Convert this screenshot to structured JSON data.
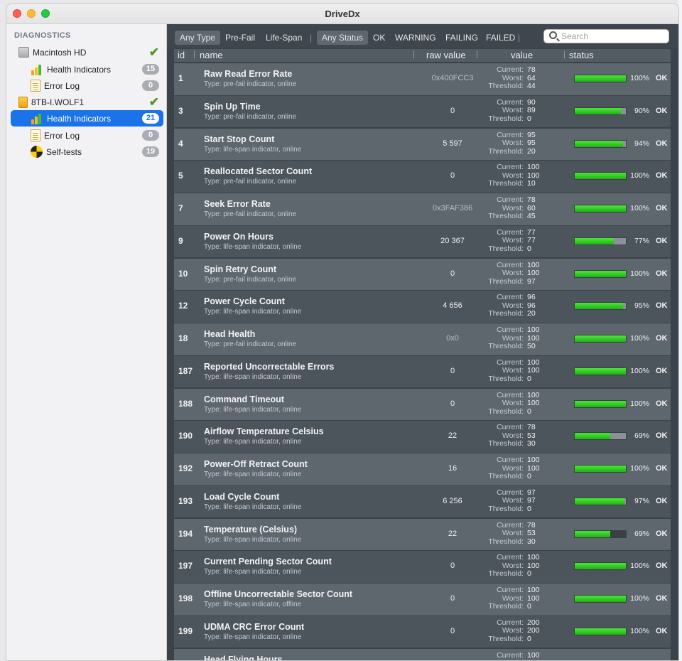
{
  "window": {
    "title": "DriveDx"
  },
  "sidebar": {
    "heading": "DIAGNOSTICS",
    "items": [
      {
        "label": "Macintosh HD"
      },
      {
        "label": "Health Indicators",
        "badge": "15"
      },
      {
        "label": "Error Log",
        "badge": "0"
      },
      {
        "label": "8TB-I.WOLF1"
      },
      {
        "label": "Health Indicators",
        "badge": "21"
      },
      {
        "label": "Error Log",
        "badge": "0"
      },
      {
        "label": "Self-tests",
        "badge": "19"
      }
    ]
  },
  "filters": {
    "type": [
      "Any Type",
      "Pre-Fail",
      "Life-Span"
    ],
    "status": [
      "Any Status",
      "OK",
      "WARNING",
      "FAILING",
      "FAILED"
    ],
    "search_placeholder": "Search"
  },
  "columns": {
    "id": "id",
    "name": "name",
    "raw": "raw value",
    "value": "value",
    "status": "status"
  },
  "labels": {
    "current": "Current:",
    "worst": "Worst:",
    "threshold": "Threshold:"
  },
  "rows": [
    {
      "id": "1",
      "name": "Raw Read Error Rate",
      "type": "Type: pre-fail indicator, online",
      "raw": "0x400FCC3",
      "hex": true,
      "current": "78",
      "worst": "64",
      "threshold": "44",
      "pct": "100%",
      "fill": 1.0,
      "status": "OK"
    },
    {
      "id": "3",
      "name": "Spin Up Time",
      "type": "Type: pre-fail indicator, online",
      "raw": "0",
      "hex": false,
      "current": "90",
      "worst": "89",
      "threshold": "0",
      "pct": "90%",
      "fill": 0.9,
      "status": "OK"
    },
    {
      "id": "4",
      "name": "Start Stop Count",
      "type": "Type: life-span indicator, online",
      "raw": "5 597",
      "hex": false,
      "current": "95",
      "worst": "95",
      "threshold": "20",
      "pct": "94%",
      "fill": 0.94,
      "status": "OK"
    },
    {
      "id": "5",
      "name": "Reallocated Sector Count",
      "type": "Type: pre-fail indicator, online",
      "raw": "0",
      "hex": false,
      "current": "100",
      "worst": "100",
      "threshold": "10",
      "pct": "100%",
      "fill": 1.0,
      "status": "OK"
    },
    {
      "id": "7",
      "name": "Seek Error Rate",
      "type": "Type: pre-fail indicator, online",
      "raw": "0x3FAF386",
      "hex": true,
      "current": "78",
      "worst": "60",
      "threshold": "45",
      "pct": "100%",
      "fill": 1.0,
      "status": "OK"
    },
    {
      "id": "9",
      "name": "Power On Hours",
      "type": "Type: life-span indicator, online",
      "raw": "20 367",
      "hex": false,
      "current": "77",
      "worst": "77",
      "threshold": "0",
      "pct": "77%",
      "fill": 0.77,
      "status": "OK"
    },
    {
      "id": "10",
      "name": "Spin Retry Count",
      "type": "Type: pre-fail indicator, online",
      "raw": "0",
      "hex": false,
      "current": "100",
      "worst": "100",
      "threshold": "97",
      "pct": "100%",
      "fill": 1.0,
      "status": "OK"
    },
    {
      "id": "12",
      "name": "Power Cycle Count",
      "type": "Type: life-span indicator, online",
      "raw": "4 656",
      "hex": false,
      "current": "96",
      "worst": "96",
      "threshold": "20",
      "pct": "95%",
      "fill": 0.95,
      "status": "OK"
    },
    {
      "id": "18",
      "name": "Head Health",
      "type": "Type: pre-fail indicator, online",
      "raw": "0x0",
      "hex": true,
      "current": "100",
      "worst": "100",
      "threshold": "50",
      "pct": "100%",
      "fill": 1.0,
      "status": "OK"
    },
    {
      "id": "187",
      "name": "Reported Uncorrectable Errors",
      "type": "Type: life-span indicator, online",
      "raw": "0",
      "hex": false,
      "current": "100",
      "worst": "100",
      "threshold": "0",
      "pct": "100%",
      "fill": 1.0,
      "status": "OK"
    },
    {
      "id": "188",
      "name": "Command Timeout",
      "type": "Type: life-span indicator, online",
      "raw": "0",
      "hex": false,
      "current": "100",
      "worst": "100",
      "threshold": "0",
      "pct": "100%",
      "fill": 1.0,
      "status": "OK"
    },
    {
      "id": "190",
      "name": "Airflow Temperature Celsius",
      "type": "Type: life-span indicator, online",
      "raw": "22",
      "hex": false,
      "current": "78",
      "worst": "53",
      "threshold": "30",
      "pct": "69%",
      "fill": 0.69,
      "status": "OK"
    },
    {
      "id": "192",
      "name": "Power-Off Retract Count",
      "type": "Type: life-span indicator, online",
      "raw": "16",
      "hex": false,
      "current": "100",
      "worst": "100",
      "threshold": "0",
      "pct": "100%",
      "fill": 1.0,
      "status": "OK"
    },
    {
      "id": "193",
      "name": "Load Cycle Count",
      "type": "Type: life-span indicator, online",
      "raw": "6 256",
      "hex": false,
      "current": "97",
      "worst": "97",
      "threshold": "0",
      "pct": "97%",
      "fill": 0.97,
      "status": "OK"
    },
    {
      "id": "194",
      "name": "Temperature (Celsius)",
      "type": "Type: life-span indicator, online",
      "raw": "22",
      "hex": false,
      "current": "78",
      "worst": "53",
      "threshold": "30",
      "pct": "69%",
      "fill": 0.69,
      "status": "OK",
      "dark_track": true
    },
    {
      "id": "197",
      "name": "Current Pending Sector Count",
      "type": "Type: life-span indicator, online",
      "raw": "0",
      "hex": false,
      "current": "100",
      "worst": "100",
      "threshold": "0",
      "pct": "100%",
      "fill": 1.0,
      "status": "OK"
    },
    {
      "id": "198",
      "name": "Offline Uncorrectable Sector Count",
      "type": "Type: life-span indicator, offline",
      "raw": "0",
      "hex": false,
      "current": "100",
      "worst": "100",
      "threshold": "0",
      "pct": "100%",
      "fill": 1.0,
      "status": "OK"
    },
    {
      "id": "199",
      "name": "UDMA CRC Error Count",
      "type": "Type: life-span indicator, online",
      "raw": "0",
      "hex": false,
      "current": "200",
      "worst": "200",
      "threshold": "0",
      "pct": "100%",
      "fill": 1.0,
      "status": "OK"
    },
    {
      "id": "",
      "name": "Head Flying Hours",
      "type": "",
      "raw": "",
      "hex": false,
      "current": "100",
      "worst": "",
      "threshold": "",
      "pct": "",
      "fill": null,
      "status": ""
    }
  ]
}
